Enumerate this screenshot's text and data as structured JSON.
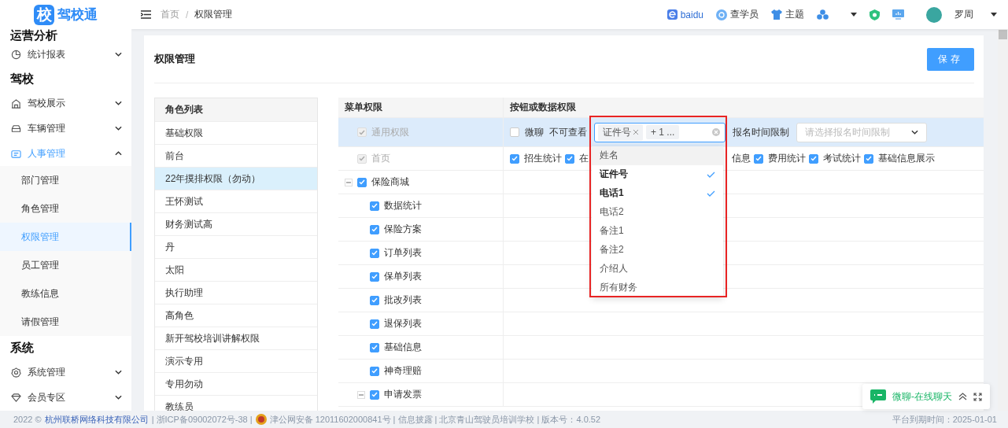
{
  "logo": {
    "mark": "校",
    "name": "驾校通"
  },
  "sidebar": {
    "sections": [
      {
        "title": "运营分析",
        "items": [
          {
            "label": "统计报表",
            "expanded": false
          }
        ]
      },
      {
        "title": "驾校",
        "items": [
          {
            "label": "驾校展示",
            "expanded": false
          },
          {
            "label": "车辆管理",
            "expanded": false
          },
          {
            "label": "人事管理",
            "expanded": true,
            "children": [
              {
                "label": "部门管理",
                "selected": false
              },
              {
                "label": "角色管理",
                "selected": false
              },
              {
                "label": "权限管理",
                "selected": true
              },
              {
                "label": "员工管理",
                "selected": false
              },
              {
                "label": "教练信息",
                "selected": false
              },
              {
                "label": "请假管理",
                "selected": false
              }
            ]
          }
        ]
      },
      {
        "title": "系统",
        "items": [
          {
            "label": "系统管理",
            "expanded": false
          },
          {
            "label": "会员专区",
            "expanded": false
          }
        ]
      }
    ]
  },
  "header": {
    "breadcrumb": [
      "首页",
      "权限管理"
    ],
    "separator": "/",
    "links": [
      {
        "label": "baidu"
      },
      {
        "label": "查学员"
      },
      {
        "label": "主题"
      }
    ],
    "user": "罗周"
  },
  "card": {
    "title": "权限管理",
    "save": "保存"
  },
  "roles": {
    "header": "角色列表",
    "items": [
      {
        "label": "基础权限",
        "selected": false
      },
      {
        "label": "前台",
        "selected": false
      },
      {
        "label": "22年摸排权限（勿动）",
        "selected": true
      },
      {
        "label": "王怀测试",
        "selected": false
      },
      {
        "label": "财务测试高",
        "selected": false
      },
      {
        "label": "丹",
        "selected": false
      },
      {
        "label": "太阳",
        "selected": false
      },
      {
        "label": "执行助理",
        "selected": false
      },
      {
        "label": "高角色",
        "selected": false
      },
      {
        "label": "新开驾校培训讲解权限",
        "selected": false
      },
      {
        "label": "演示专用",
        "selected": false
      },
      {
        "label": "专用勿动",
        "selected": false
      },
      {
        "label": "教练员",
        "selected": false
      }
    ]
  },
  "permissions": {
    "columns": [
      "菜单权限",
      "按钮或数据权限"
    ],
    "general": {
      "label": "通用权限",
      "checked": true,
      "disabled": true,
      "chat": {
        "label": "微聊",
        "checked": false
      },
      "hide_label": "不可查看",
      "tags": [
        {
          "label": "证件号",
          "kind": "tag"
        },
        {
          "label": "+ 1 ...",
          "kind": "count"
        }
      ],
      "options": [
        {
          "label": "姓名",
          "selected": false,
          "hovered": true
        },
        {
          "label": "证件号",
          "selected": true,
          "hovered": false
        },
        {
          "label": "电话1",
          "selected": true,
          "hovered": false
        },
        {
          "label": "电话2",
          "selected": false,
          "hovered": false
        },
        {
          "label": "备注1",
          "selected": false,
          "hovered": false
        },
        {
          "label": "备注2",
          "selected": false,
          "hovered": false
        },
        {
          "label": "介绍人",
          "selected": false,
          "hovered": false
        },
        {
          "label": "所有财务",
          "selected": false,
          "hovered": false
        }
      ],
      "date_label": "报名时间限制",
      "date_placeholder": "请选择报名时间限制"
    },
    "home": {
      "label": "首页",
      "checked": true,
      "disabled": true,
      "options": [
        {
          "label": "招生统计",
          "checked": true,
          "kind": "checkbox"
        },
        {
          "label": "在",
          "checked": true,
          "kind": "checkbox"
        },
        {
          "label": "信息",
          "kind": "partial"
        },
        {
          "label": "费用统计",
          "checked": true,
          "kind": "checkbox"
        },
        {
          "label": "考试统计",
          "checked": true,
          "kind": "checkbox"
        },
        {
          "label": "基础信息展示",
          "checked": true,
          "kind": "checkbox"
        }
      ]
    },
    "tree": [
      {
        "label": "保险商城",
        "checked": true,
        "expanded": true,
        "children": [
          {
            "label": "数据统计",
            "checked": true
          },
          {
            "label": "保险方案",
            "checked": true
          },
          {
            "label": "订单列表",
            "checked": true
          },
          {
            "label": "保单列表",
            "checked": true
          },
          {
            "label": "批改列表",
            "checked": true
          },
          {
            "label": "退保列表",
            "checked": true
          },
          {
            "label": "基础信息",
            "checked": true
          },
          {
            "label": "神奇理赔",
            "checked": true
          },
          {
            "label": "申请发票",
            "checked": true,
            "expanded": true
          }
        ]
      }
    ]
  },
  "chat": {
    "label": "微聊-在线聊天"
  },
  "footer": {
    "left": [
      {
        "kind": "text",
        "text": "2022 ©"
      },
      {
        "kind": "link",
        "text": "杭州联桥网络科技有限公司"
      },
      {
        "kind": "text",
        "text": "| 浙ICP备09002072号-38 |"
      },
      {
        "kind": "police",
        "text": "津公网安备 12011602000841号 | 信息披露 | 北京青山驾驶员培训学校 | 版本号：4.0.52"
      }
    ],
    "right": "平台到期时间：2025-01-01"
  }
}
